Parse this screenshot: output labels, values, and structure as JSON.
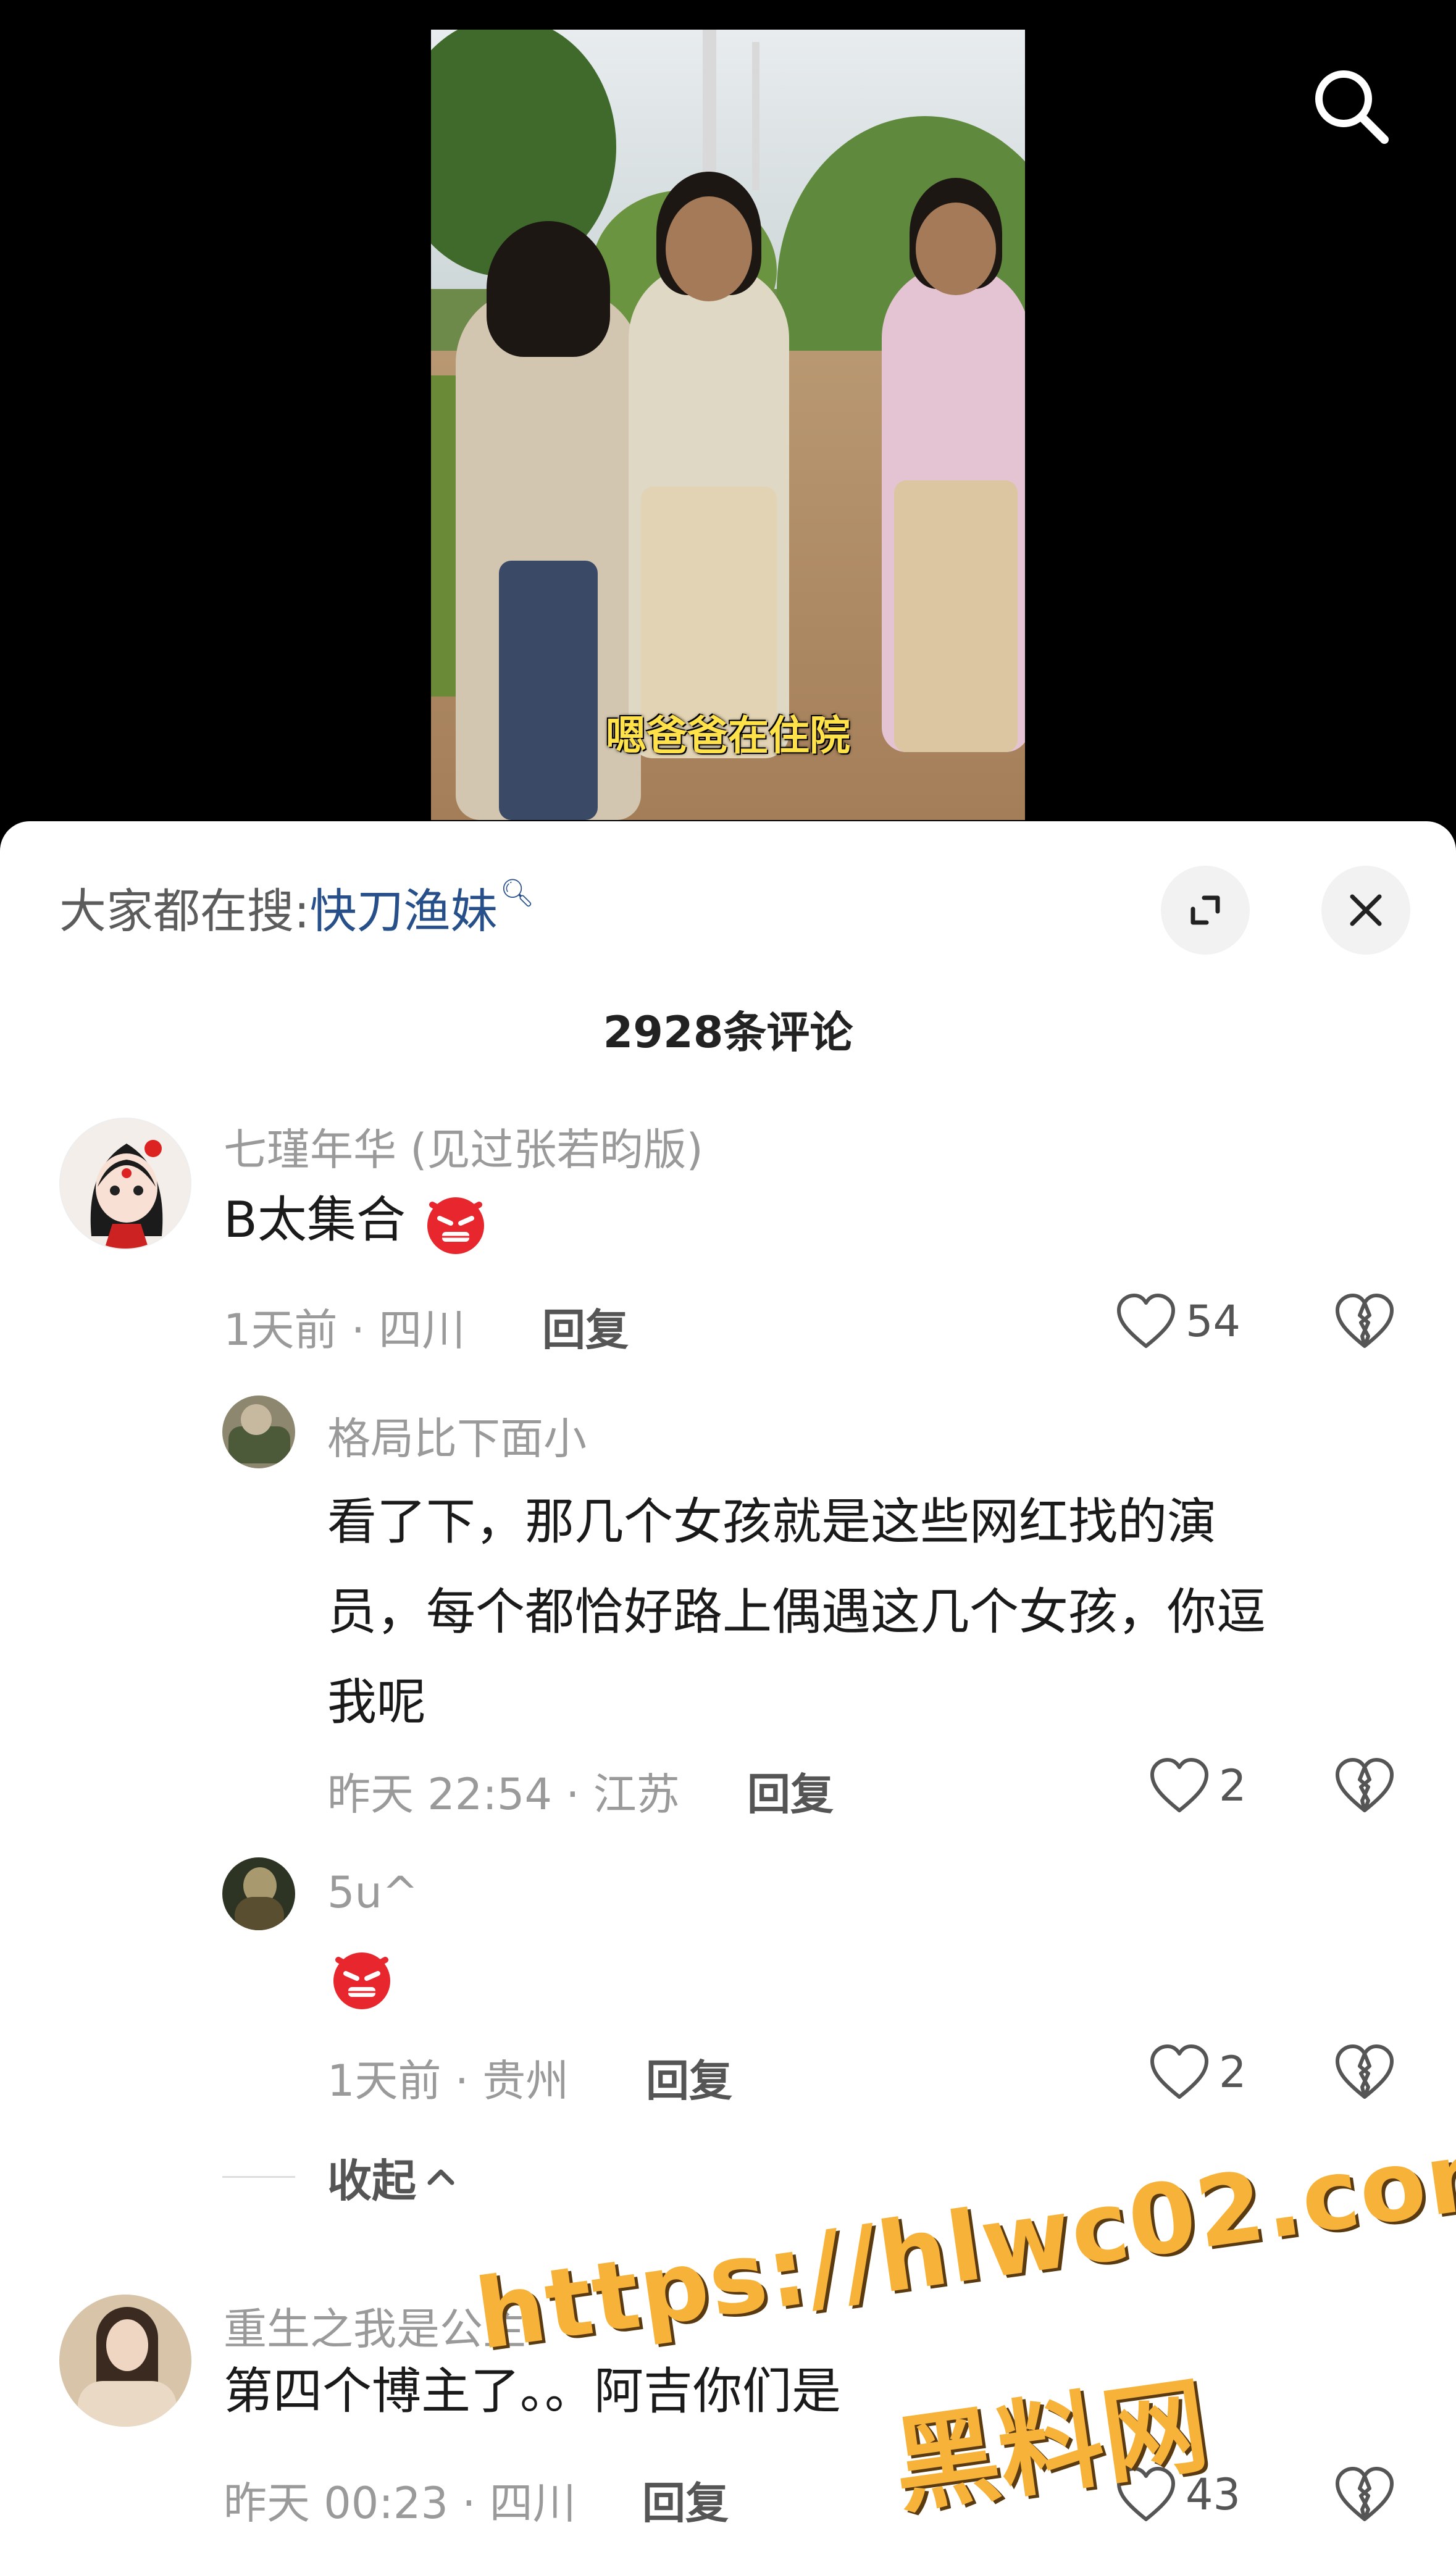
{
  "video": {
    "subtitle": "嗯爸爸在住院"
  },
  "header": {
    "hot_search_label": "大家都在搜:",
    "hot_search_term": "快刀渔妹",
    "comment_count": "2928条评论"
  },
  "comments": [
    {
      "name": "七瑾年华 (见过张若昀版)",
      "text": "B太集合",
      "meta": "1天前 · 四川",
      "reply_label": "回复",
      "likes": "54",
      "replies": [
        {
          "name": "格局比下面小",
          "text_lines": [
            "看了下，那几个女孩就是这些网红找的演",
            "员，每个都恰好路上偶遇这几个女孩，你逗",
            "我呢"
          ],
          "meta": "昨天 22:54 · 江苏",
          "reply_label": "回复",
          "likes": "2"
        },
        {
          "name": "5u^",
          "text": "",
          "meta": "1天前 · 贵州",
          "reply_label": "回复",
          "likes": "2"
        }
      ],
      "collapse_label": "收起"
    },
    {
      "name": "重生之我是公主",
      "text": "第四个博主了。。阿吉你们是",
      "meta": "昨天 00:23 · 四川",
      "reply_label": "回复",
      "likes": "43"
    }
  ],
  "watermark": {
    "url": "https://hlwc02.com",
    "name": "黑料网"
  },
  "colors": {
    "link_blue": "#27508a",
    "muted_gray": "#9a9a9a",
    "watermark_orange": "#f7b23a"
  }
}
